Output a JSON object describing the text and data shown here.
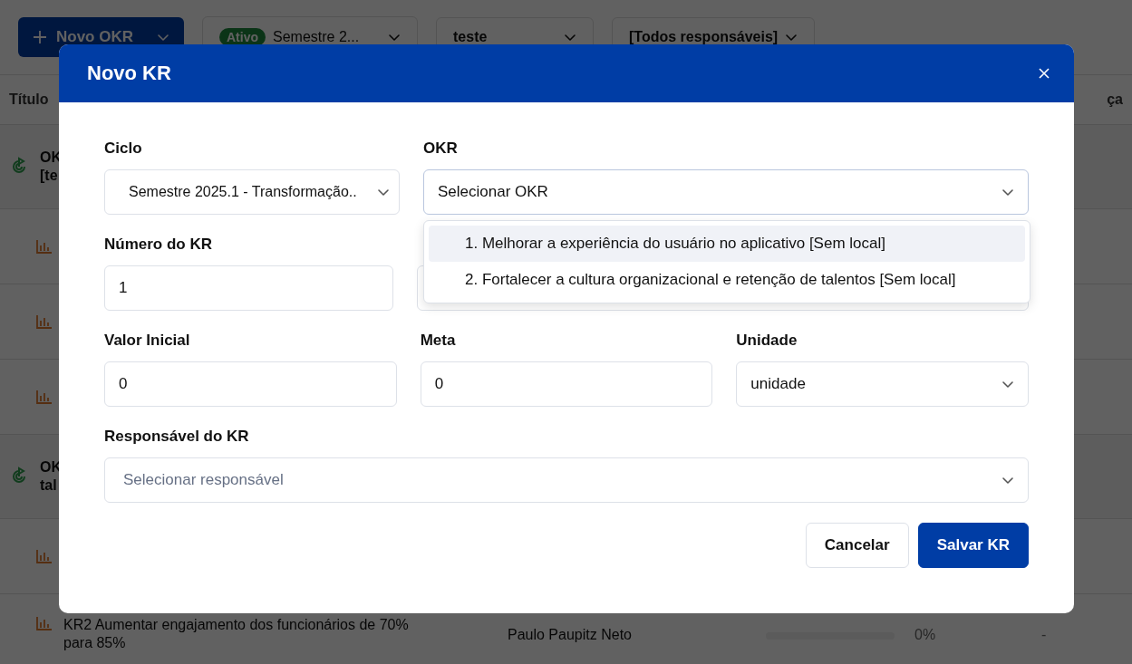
{
  "toolbar": {
    "new_button": "Novo OKR",
    "cycle_filter": {
      "badge": "Ativo",
      "value": "Semestre 2..."
    },
    "team_filter": "teste",
    "owner_filter": "[Todos responsáveis]"
  },
  "table": {
    "columns": [
      "Título",
      "ça"
    ],
    "rows": [
      {
        "kind": "okr",
        "lines": [
          "OK",
          "[te"
        ]
      },
      {
        "kind": "kr"
      },
      {
        "kind": "kr"
      },
      {
        "kind": "kr"
      },
      {
        "kind": "okr",
        "lines": [
          "OK",
          "tal"
        ]
      },
      {
        "kind": "kr"
      },
      {
        "kind": "kr",
        "lines": [
          "KR2 Aumentar engajamento dos funcionários de 70%",
          "para 85%"
        ],
        "owner": "Paulo Paupitz Neto",
        "level": 0,
        "progress": "0%",
        "trend": "-"
      }
    ]
  },
  "modal": {
    "title": "Novo KR",
    "form": [
      [
        {
          "kind": "select",
          "label": "Ciclo",
          "value": "Semestre 2025.1 - Transformação.."
        },
        {
          "kind": "select",
          "label": "OKR",
          "value": "Selecionar OKR",
          "expanded": true,
          "options": [
            {
              "label": "1. Melhorar a experiência do usuário no aplicativo [Sem local]",
              "selected": true
            },
            {
              "label": "2. Fortalecer a cultura organizacional e retenção de talentos [Sem local]",
              "selected": false
            }
          ]
        }
      ],
      [
        {
          "kind": "input",
          "label": "Número do KR",
          "value": "1"
        },
        {
          "kind": "input"
        }
      ],
      [
        {
          "kind": "input",
          "label": "Valor Inicial",
          "value": "0"
        },
        {
          "kind": "input",
          "label": "Meta",
          "value": "0"
        },
        {
          "kind": "select",
          "label": "Unidade",
          "value": "unidade"
        }
      ],
      [
        {
          "kind": "select",
          "label": "Responsável do KR",
          "placeholder": "Selecionar responsável"
        }
      ]
    ],
    "buttons": [
      {
        "kind": "secondary",
        "label": "Cancelar"
      },
      {
        "kind": "primary",
        "label": "Salvar KR"
      }
    ]
  }
}
